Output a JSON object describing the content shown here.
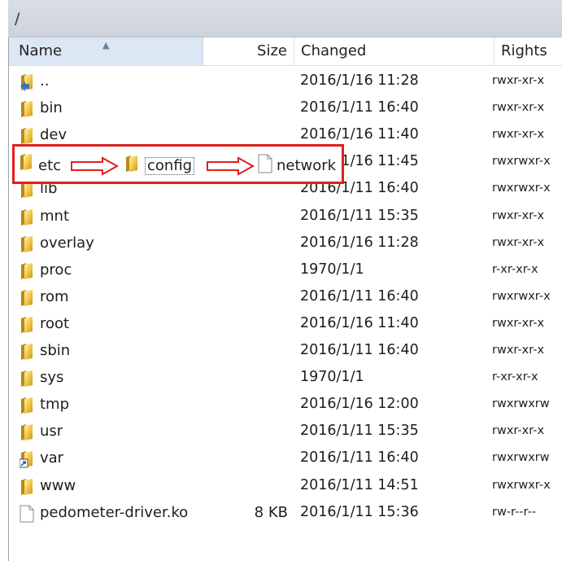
{
  "path": "/",
  "columns": {
    "name": "Name",
    "size": "Size",
    "changed": "Changed",
    "rights": "Rights"
  },
  "rows": [
    {
      "name": "..",
      "size": "",
      "changed": "2016/1/16 11:28",
      "rights": "rwxr-xr-x",
      "icon": "parent-folder-icon"
    },
    {
      "name": "bin",
      "size": "",
      "changed": "2016/1/11 16:40",
      "rights": "rwxr-xr-x",
      "icon": "folder-icon"
    },
    {
      "name": "dev",
      "size": "",
      "changed": "2016/1/16 11:40",
      "rights": "rwxr-xr-x",
      "icon": "folder-icon"
    },
    {
      "name": "etc",
      "size": "",
      "changed": "2016/1/16 11:45",
      "rights": "rwxrwxr-x",
      "icon": "folder-icon"
    },
    {
      "name": "lib",
      "size": "",
      "changed": "2016/1/11 16:40",
      "rights": "rwxrwxr-x",
      "icon": "folder-icon"
    },
    {
      "name": "mnt",
      "size": "",
      "changed": "2016/1/11 15:35",
      "rights": "rwxr-xr-x",
      "icon": "folder-icon"
    },
    {
      "name": "overlay",
      "size": "",
      "changed": "2016/1/16 11:28",
      "rights": "rwxr-xr-x",
      "icon": "folder-icon"
    },
    {
      "name": "proc",
      "size": "",
      "changed": "1970/1/1",
      "rights": "r-xr-xr-x",
      "icon": "folder-icon"
    },
    {
      "name": "rom",
      "size": "",
      "changed": "2016/1/11 16:40",
      "rights": "rwxrwxr-x",
      "icon": "folder-icon"
    },
    {
      "name": "root",
      "size": "",
      "changed": "2016/1/16 11:40",
      "rights": "rwxr-xr-x",
      "icon": "folder-icon"
    },
    {
      "name": "sbin",
      "size": "",
      "changed": "2016/1/11 16:40",
      "rights": "rwxr-xr-x",
      "icon": "folder-icon"
    },
    {
      "name": "sys",
      "size": "",
      "changed": "1970/1/1",
      "rights": "r-xr-xr-x",
      "icon": "folder-icon"
    },
    {
      "name": "tmp",
      "size": "",
      "changed": "2016/1/16 12:00",
      "rights": "rwxrwxrw",
      "icon": "folder-icon"
    },
    {
      "name": "usr",
      "size": "",
      "changed": "2016/1/11 15:35",
      "rights": "rwxr-xr-x",
      "icon": "folder-icon"
    },
    {
      "name": "var",
      "size": "",
      "changed": "2016/1/11 16:40",
      "rights": "rwxrwxrw",
      "icon": "folder-link-icon"
    },
    {
      "name": "www",
      "size": "",
      "changed": "2016/1/11 14:51",
      "rights": "rwxrwxr-x",
      "icon": "folder-icon"
    },
    {
      "name": "pedometer-driver.ko",
      "size": "8 KB",
      "changed": "2016/1/11 15:36",
      "rights": "rw-r--r--",
      "icon": "file-icon"
    }
  ],
  "callout": {
    "folder1": "etc",
    "folder2": "config",
    "file": "network"
  },
  "colors": {
    "highlight": "#e02020",
    "folder": "#e9b722",
    "header_sorted": "#dbe8f4"
  }
}
